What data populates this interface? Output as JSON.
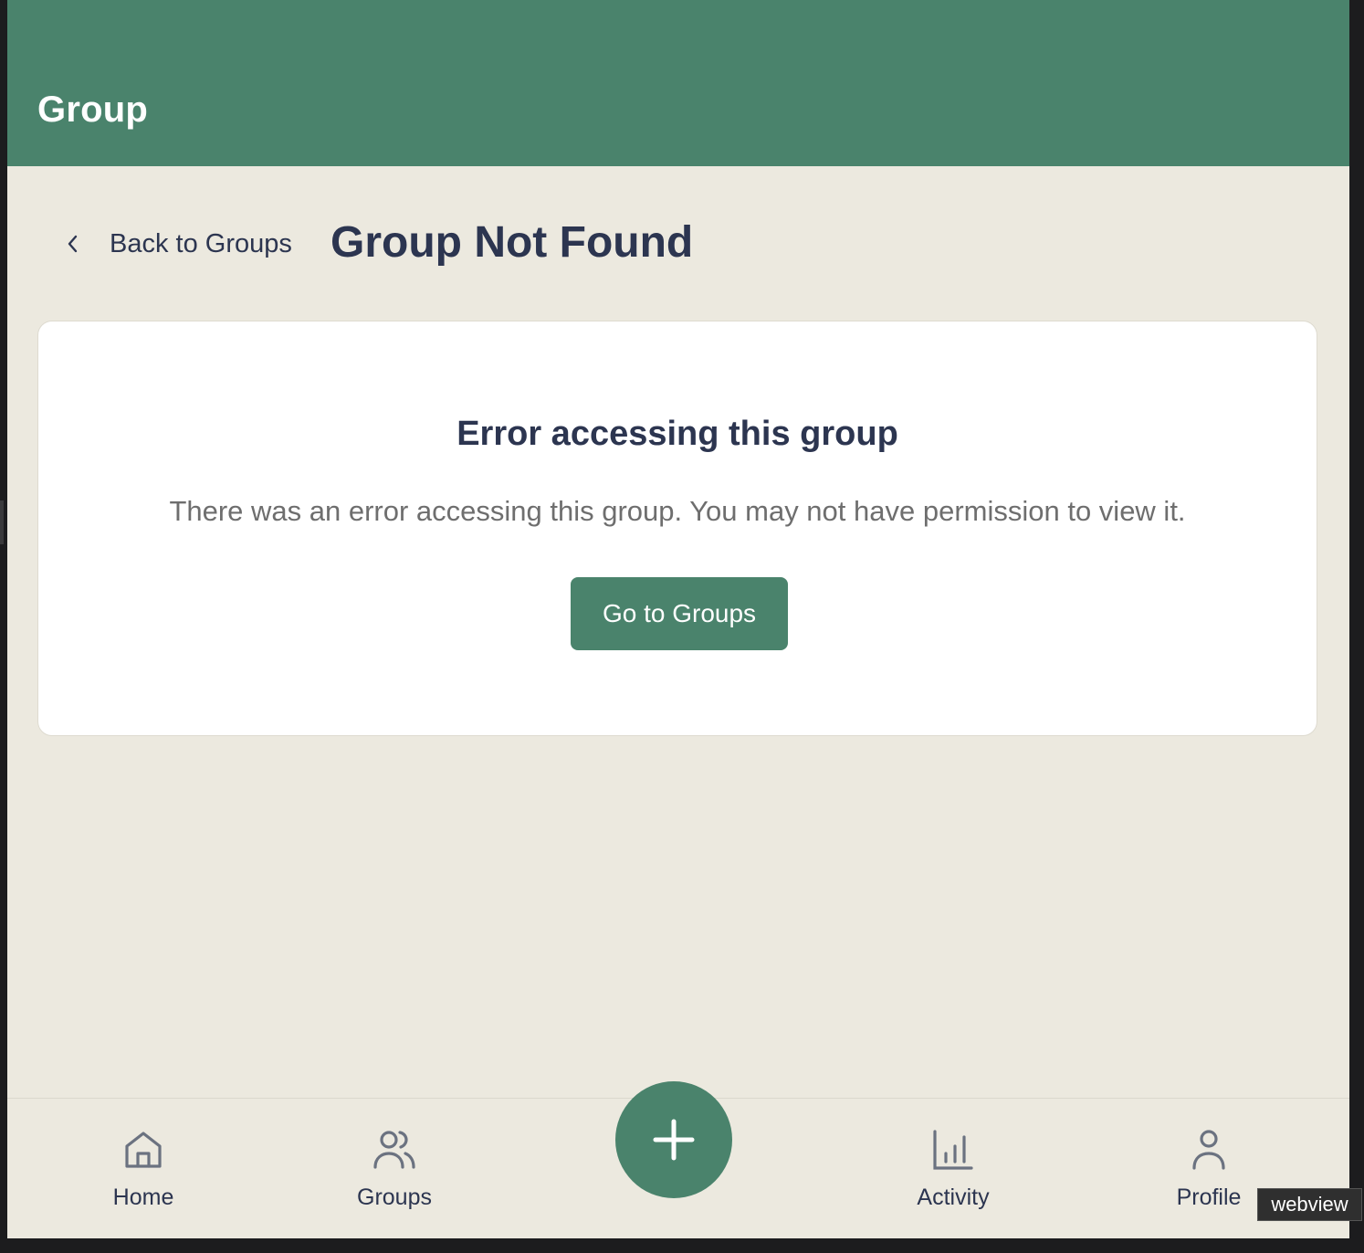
{
  "header": {
    "title": "Group"
  },
  "page": {
    "back_label": "Back to Groups",
    "title": "Group Not Found"
  },
  "error_card": {
    "heading": "Error accessing this group",
    "message": "There was an error accessing this group. You may not have permission to view it.",
    "button_label": "Go to Groups"
  },
  "bottom_nav": {
    "items": [
      {
        "label": "Home",
        "icon": "home-icon"
      },
      {
        "label": "Groups",
        "icon": "users-icon"
      },
      {
        "label": "Activity",
        "icon": "bar-chart-icon"
      },
      {
        "label": "Profile",
        "icon": "user-icon"
      }
    ],
    "fab_icon": "plus-icon"
  },
  "overlay": {
    "badge": "webview"
  },
  "colors": {
    "brand": "#4a836c",
    "background": "#ece9df",
    "text_primary": "#2c3550",
    "text_muted": "#6e6e6e"
  }
}
